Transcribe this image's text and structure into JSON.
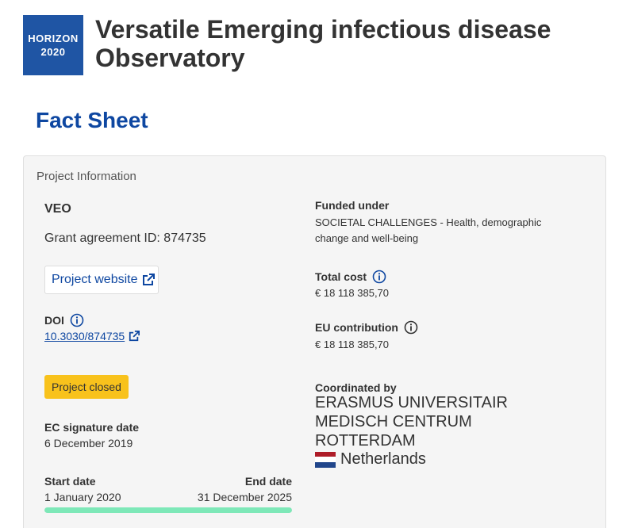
{
  "header": {
    "logo_line1": "HORIZON",
    "logo_line2": "2020",
    "title": "Versatile Emerging infectious disease Observatory"
  },
  "fact_sheet_heading": "Fact Sheet",
  "project_info": {
    "panel_title": "Project Information",
    "acronym": "VEO",
    "grant_agreement": "Grant agreement ID: 874735",
    "website_label": "Project website",
    "doi_label": "DOI",
    "doi_value": "10.3030/874735",
    "status": "Project closed",
    "ec_signature_label": "EC signature date",
    "ec_signature_value": "6 December 2019",
    "start_label": "Start date",
    "start_value": "1 January 2020",
    "end_label": "End date",
    "end_value": "31 December 2025",
    "progress_percent": 100,
    "funded_label": "Funded under",
    "funded_value": "SOCIETAL CHALLENGES - Health, demographic change and well-being",
    "total_cost_label": "Total cost",
    "total_cost_value": "€ 18 118 385,70",
    "eu_contribution_label": "EU contribution",
    "eu_contribution_value": "€ 18 118 385,70",
    "coordinated_label": "Coordinated by",
    "coordinator_name": "ERASMUS UNIVERSITAIR MEDISCH CENTRUM ROTTERDAM",
    "country": "Netherlands",
    "flag_colors": [
      "#ae1c28",
      "#ffffff",
      "#21468b"
    ]
  },
  "colors": {
    "brand_blue": "#0e47a1",
    "logo_blue": "#1f55a4",
    "status_yellow": "#f8c21c",
    "progress_green": "#7ee8b8"
  }
}
